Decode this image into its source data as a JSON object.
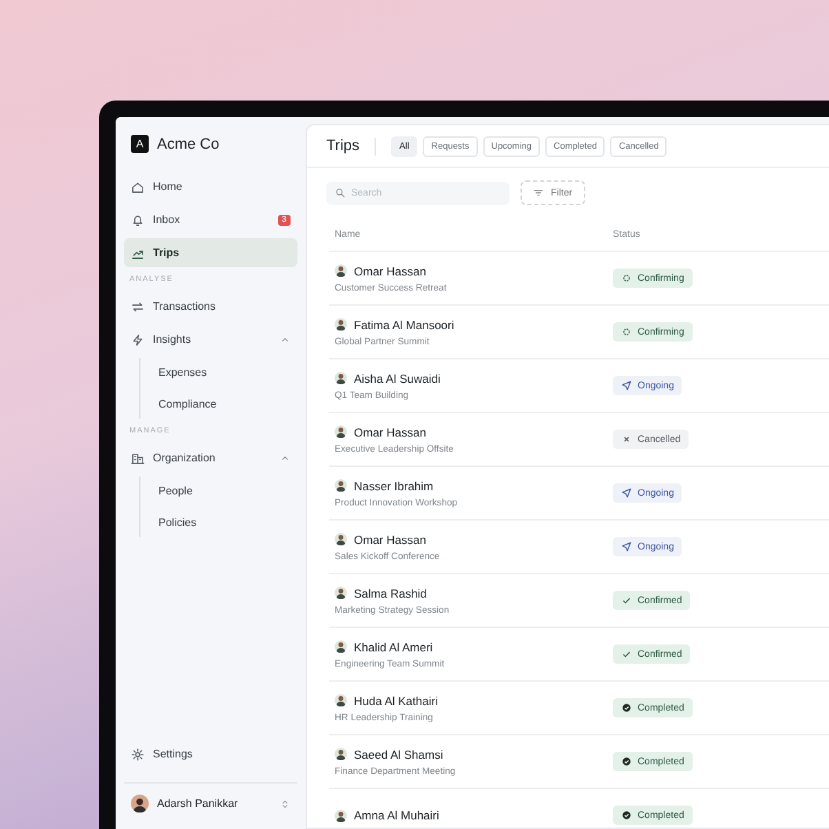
{
  "brand": {
    "name": "Acme Co",
    "logo": "A"
  },
  "sidebar": {
    "items": [
      {
        "label": "Home",
        "kind": "home",
        "selected": false
      },
      {
        "label": "Inbox",
        "kind": "bell",
        "selected": false,
        "badge": "3"
      },
      {
        "label": "Trips",
        "kind": "trips",
        "selected": true
      }
    ],
    "sections": [
      {
        "title": "ANALYSE",
        "items": [
          {
            "label": "Transactions",
            "kind": "swap",
            "selected": false
          },
          {
            "label": "Insights",
            "kind": "bolt",
            "selected": false,
            "expanded": true,
            "children": [
              {
                "label": "Expenses"
              },
              {
                "label": "Compliance"
              }
            ]
          }
        ]
      },
      {
        "title": "MANAGE",
        "items": [
          {
            "label": "Organization",
            "kind": "building",
            "selected": false,
            "expanded": true,
            "children": [
              {
                "label": "People"
              },
              {
                "label": "Policies"
              }
            ]
          }
        ]
      }
    ],
    "settings": "Settings",
    "user": "Adarsh Panikkar"
  },
  "page": {
    "title": "Trips",
    "tabs": [
      {
        "label": "All",
        "selected": true
      },
      {
        "label": "Requests",
        "selected": false
      },
      {
        "label": "Upcoming",
        "selected": false
      },
      {
        "label": "Completed",
        "selected": false
      },
      {
        "label": "Cancelled",
        "selected": false
      }
    ],
    "search": {
      "placeholder": "Search"
    },
    "filter": "Filter"
  },
  "table": {
    "columns": [
      "Name",
      "Status"
    ],
    "rows": [
      {
        "name": "Omar Hassan",
        "trip": "Customer Success Retreat",
        "status": "Confirming",
        "kind": "confirming"
      },
      {
        "name": "Fatima Al Mansoori",
        "trip": "Global Partner Summit",
        "status": "Confirming",
        "kind": "confirming"
      },
      {
        "name": "Aisha Al Suwaidi",
        "trip": "Q1 Team Building",
        "status": "Ongoing",
        "kind": "ongoing"
      },
      {
        "name": "Omar Hassan",
        "trip": "Executive Leadership Offsite",
        "status": "Cancelled",
        "kind": "cancelled"
      },
      {
        "name": "Nasser Ibrahim",
        "trip": "Product Innovation Workshop",
        "status": "Ongoing",
        "kind": "ongoing"
      },
      {
        "name": "Omar Hassan",
        "trip": "Sales Kickoff Conference",
        "status": "Ongoing",
        "kind": "ongoing"
      },
      {
        "name": "Salma Rashid",
        "trip": "Marketing Strategy Session",
        "status": "Confirmed",
        "kind": "confirmed"
      },
      {
        "name": "Khalid Al Ameri",
        "trip": "Engineering Team Summit",
        "status": "Confirmed",
        "kind": "confirmed"
      },
      {
        "name": "Huda Al Kathairi",
        "trip": "HR Leadership Training",
        "status": "Completed",
        "kind": "completed"
      },
      {
        "name": "Saeed Al Shamsi",
        "trip": "Finance Department Meeting",
        "status": "Completed",
        "kind": "completed"
      },
      {
        "name": "Amna Al Muhairi",
        "status": "Completed",
        "kind": "completed"
      }
    ]
  }
}
